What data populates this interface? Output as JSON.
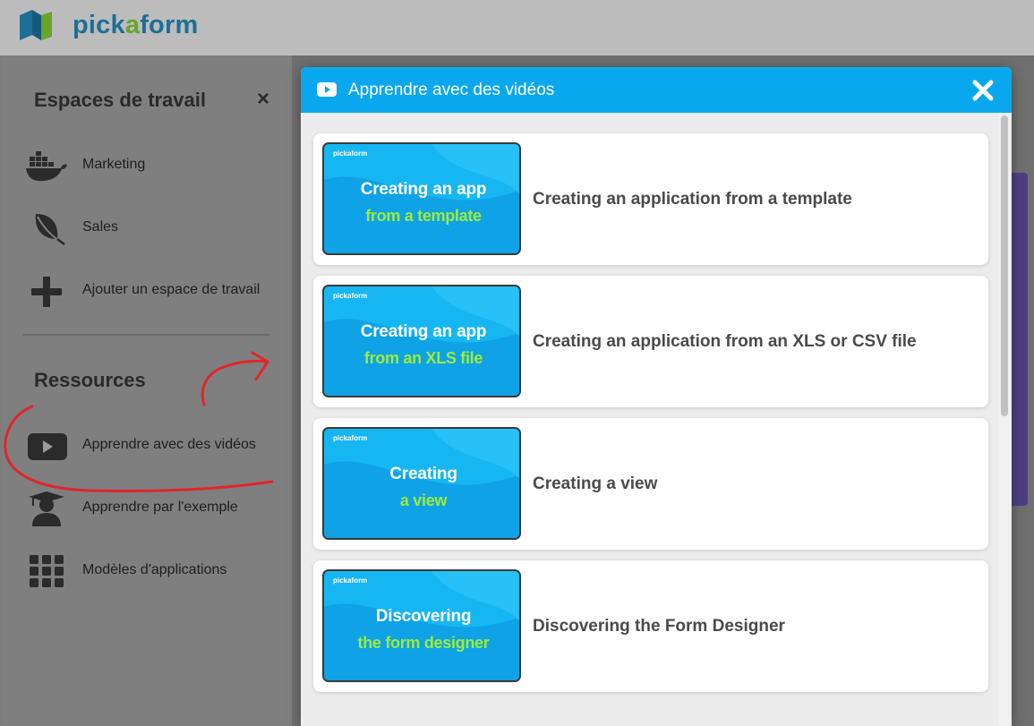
{
  "header": {
    "brand_part1": "pick",
    "brand_part2": "a",
    "brand_part3": "form"
  },
  "sidebar": {
    "workspaces_title": "Espaces de travail",
    "close_label": "×",
    "workspaces": [
      {
        "label": "Marketing",
        "icon": "whale-container-icon"
      },
      {
        "label": "Sales",
        "icon": "leaf-icon"
      },
      {
        "label": "Ajouter un espace de travail",
        "icon": "plus-icon"
      }
    ],
    "resources_title": "Ressources",
    "resources": [
      {
        "label": "Apprendre avec des vidéos",
        "icon": "youtube-play-icon"
      },
      {
        "label": "Apprendre par l'exemple",
        "icon": "graduate-user-icon"
      },
      {
        "label": "Modèles d'applications",
        "icon": "grid-icon"
      }
    ]
  },
  "modal": {
    "title": "Apprendre avec des vidéos",
    "videos": [
      {
        "thumb_brand": "pickaform",
        "thumb_line1": "Creating an app",
        "thumb_line2": "from a template",
        "title": "Creating an application from a template"
      },
      {
        "thumb_brand": "pickaform",
        "thumb_line1": "Creating an app",
        "thumb_line2": "from an XLS file",
        "title": "Creating an application from an XLS or CSV file"
      },
      {
        "thumb_brand": "pickaform",
        "thumb_line1": "Creating",
        "thumb_line2": "a view",
        "title": "Creating a view"
      },
      {
        "thumb_brand": "pickaform",
        "thumb_line1": "Discovering",
        "thumb_line2": "the form designer",
        "title": "Discovering the Form Designer"
      }
    ]
  },
  "colors": {
    "modal_header": "#09a8ee",
    "thumb_bg": "#16b6f3",
    "thumb_accent": "#9dec3a",
    "annotation": "#e0262b"
  }
}
